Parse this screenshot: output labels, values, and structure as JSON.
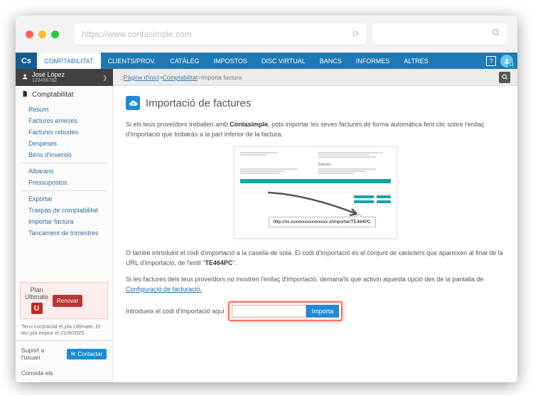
{
  "browser": {
    "url": "https://www.contasimple.com"
  },
  "brand": "Cs",
  "nav": {
    "items": [
      "COMPTABILITAT",
      "CLIENTS/PROV.",
      "CATÀLEG",
      "IMPOSTOS",
      "DISC VIRTUAL",
      "BANCS",
      "INFORMES",
      "ALTRES"
    ],
    "help": "?",
    "badge": "13"
  },
  "user": {
    "name": "José López",
    "id": "12345678Z"
  },
  "breadcrumb": {
    "home": "Pàgina d'inici",
    "section": "Comptabilitat",
    "current": "Importa factura",
    "sep": " > ",
    "prefix": ":: "
  },
  "sidebar": {
    "head": "Comptabilitat",
    "g1": [
      "Resum",
      "Factures emeses",
      "Factures rebudes",
      "Despeses",
      "Béns d'inversió"
    ],
    "g2": [
      "Albarans",
      "Pressupostos"
    ],
    "g3": [
      "Exportar",
      "Traspàs de comptabilitat",
      "Importar factura",
      "Tancament de trimestres"
    ]
  },
  "plan": {
    "label_line1": "Plan",
    "label_line2": "Ultimate",
    "badge": "U",
    "renew": "Renovar",
    "info": "Tens contractat el pla Ultimate. El teu pla expira el 21/8/2025."
  },
  "support": {
    "label": "Suport a l'usuari",
    "button": "Contactar"
  },
  "invite": {
    "label": "Convida els"
  },
  "main": {
    "title": "Importació de factures",
    "p1_a": "Si els teus proveïdors treballen amb ",
    "p1_bold": "Contasimple",
    "p1_b": ", pots importar les seves factures de forma automàtica fent clic sobre l'enllaç d'importació que trobaràs a la part inferior de la factura.",
    "bubble": "http://xx.xxxxxxxxxxxxxxxx.x/importar/TE464PC",
    "p2_a": "O també introduint el codi d'importació a la casella de sota. El codi d'importació és el conjunt de caràcters que apareixen al final de la URL d'importació, de l'estil \"",
    "p2_code": "TE464PC",
    "p2_b": "\".",
    "p3_a": "Si les factures dels teus proveïdors no mostren l'enllaç d'importació, demana'ls que activin aquesta opció des de la pantalla de ",
    "p3_link": "Configuració de facturació.",
    "input_label": "Introdueix el codi d'importació aquí",
    "import_btn": "Importa",
    "mock_client": "Clients:"
  }
}
